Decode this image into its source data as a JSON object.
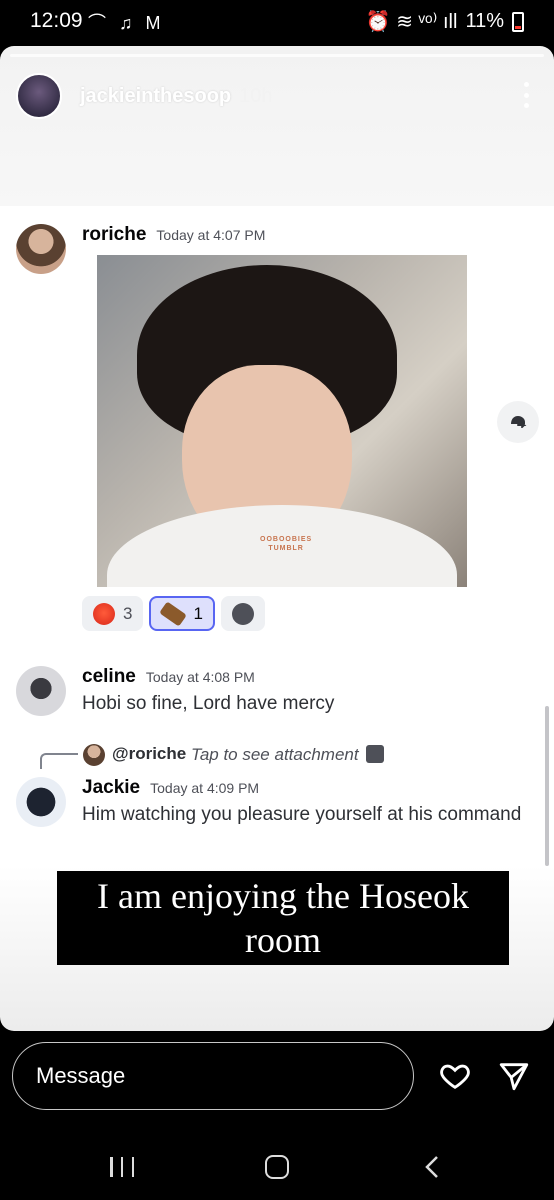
{
  "status_bar": {
    "time": "12:09",
    "left_icons": "⌒ ♫ M",
    "right_text": "⏰ ≋ ᵛᵒ⁾ ıll",
    "battery": "11%"
  },
  "story": {
    "username": "jackieinthesoop",
    "age": "10h"
  },
  "messages": [
    {
      "author": "roriche",
      "timestamp": "Today at 4:07 PM"
    },
    {
      "author": "celine",
      "timestamp": "Today at 4:08 PM",
      "text": "Hobi so fine, Lord have mercy"
    },
    {
      "author": "Jackie",
      "timestamp": "Today at 4:09 PM",
      "text": "Him watching you pleasure yourself at his command"
    }
  ],
  "image_watermark": {
    "line1": "OOBOOBIES",
    "line2": "TUMBLR"
  },
  "reactions": [
    {
      "icon": "hot-face-emoji",
      "count": "3",
      "active": false
    },
    {
      "icon": "coffin-emoji",
      "count": "1",
      "active": true
    },
    {
      "icon": "add-reaction-icon",
      "count": "",
      "active": false
    }
  ],
  "reply": {
    "mention": "@roriche",
    "tap_text": "Tap to see attachment"
  },
  "caption": "I am enjoying the Hoseok room",
  "bottom": {
    "message_placeholder": "Message"
  },
  "colors": {
    "accent": "#5865f2",
    "caption_bg": "#000000"
  }
}
